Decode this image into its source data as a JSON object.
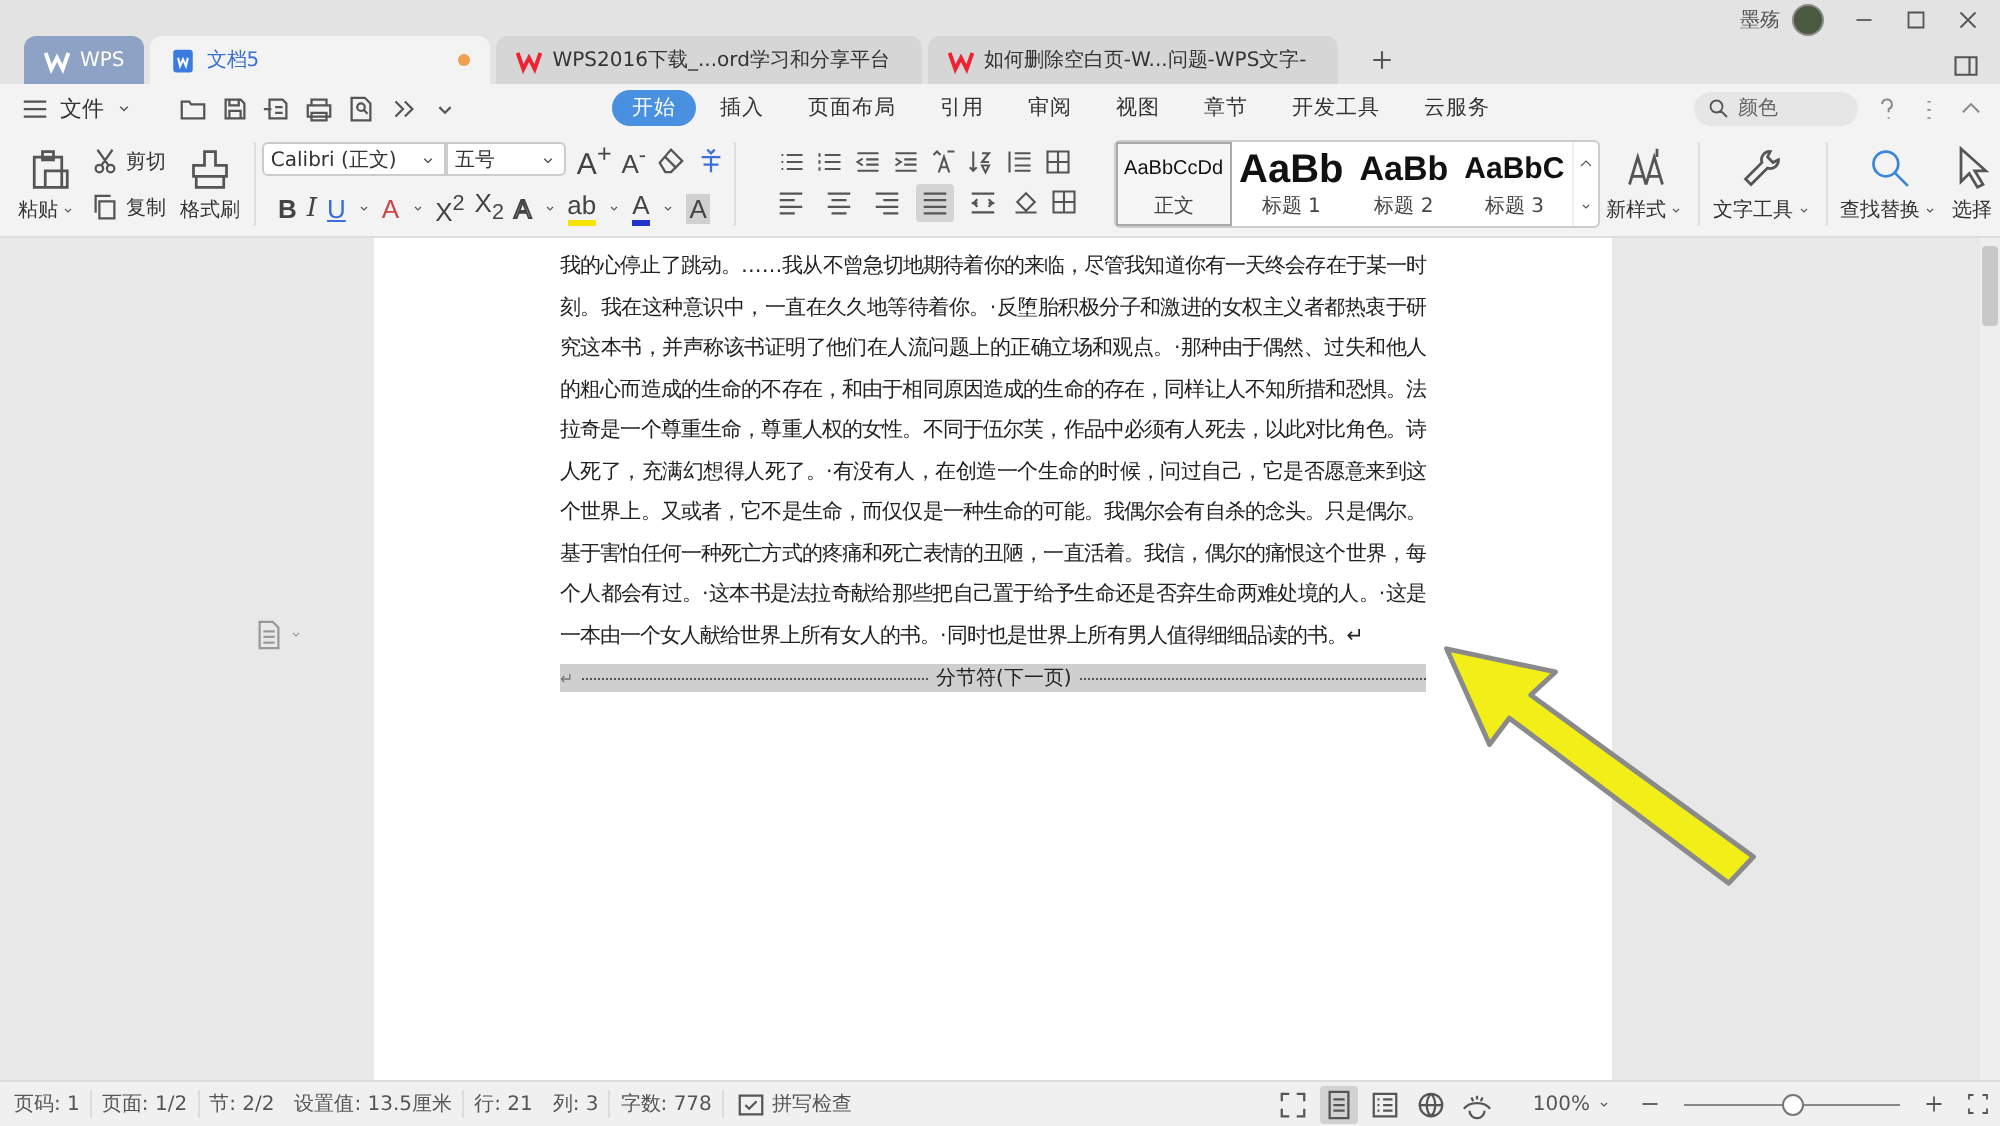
{
  "tabs": [
    {
      "kind": "home",
      "label": "WPS",
      "selected": false,
      "unsaved": false
    },
    {
      "kind": "writer",
      "label": "文档5",
      "selected": true,
      "unsaved": true
    },
    {
      "kind": "web",
      "label": "WPS2016下载_...ord学习和分享平台",
      "selected": false,
      "unsaved": false
    },
    {
      "kind": "web",
      "label": "如何删除空白页-W...问题-WPS文字-",
      "selected": false,
      "unsaved": false
    }
  ],
  "user": {
    "name": "墨殇"
  },
  "menu": {
    "file": "文件",
    "ribbon_tabs": [
      {
        "label": "开始",
        "selected": true
      },
      {
        "label": "插入",
        "selected": false
      },
      {
        "label": "页面布局",
        "selected": false
      },
      {
        "label": "引用",
        "selected": false
      },
      {
        "label": "审阅",
        "selected": false
      },
      {
        "label": "视图",
        "selected": false
      },
      {
        "label": "章节",
        "selected": false
      },
      {
        "label": "开发工具",
        "selected": false
      },
      {
        "label": "云服务",
        "selected": false
      }
    ],
    "search": {
      "value": "颜色"
    }
  },
  "ribbon": {
    "clipboard": {
      "paste": "粘贴",
      "cut": "剪切",
      "copy": "复制",
      "format_painter": "格式刷"
    },
    "font": {
      "name": "Calibri (正文)",
      "size": "五号",
      "row_1": [
        {
          "kind": "grow",
          "label": "A$^{+}$"
        },
        {
          "kind": "shrink",
          "label": "A$^{-}$"
        }
      ],
      "row_2": [
        {
          "kind": "bold",
          "label": "B"
        },
        {
          "kind": "italic",
          "label": "I"
        },
        {
          "kind": "underline",
          "label": "U"
        },
        {
          "kind": "strike",
          "label": "A"
        },
        {
          "kind": "sup",
          "label": "X$^{2}$"
        },
        {
          "kind": "sub",
          "label": "X$_{2}$"
        },
        {
          "kind": "effect",
          "label": "A"
        },
        {
          "kind": "highlight",
          "label": "ab"
        },
        {
          "kind": "color",
          "label": "A"
        },
        {
          "kind": "shade",
          "label": "A"
        }
      ]
    },
    "alignment": [
      {
        "kind": "left",
        "selected": false
      },
      {
        "kind": "center",
        "selected": false
      },
      {
        "kind": "right",
        "selected": false
      },
      {
        "kind": "justify",
        "selected": true
      },
      {
        "kind": "distributed",
        "selected": false
      }
    ],
    "styles": [
      {
        "kind": "body",
        "preview": "AaBbCcDd",
        "label": "正文",
        "selected": true
      },
      {
        "kind": "heading_1",
        "preview": "AaBb",
        "label": "标题 1",
        "selected": false
      },
      {
        "kind": "heading_2",
        "preview": "AaBb",
        "label": "标题 2",
        "selected": false
      },
      {
        "kind": "heading_3",
        "preview": "AaBbC",
        "label": "标题 3",
        "selected": false
      }
    ],
    "buttons": [
      {
        "kind": "new_style",
        "label": "新样式"
      },
      {
        "kind": "text_tools",
        "label": "文字工具"
      },
      {
        "kind": "find",
        "label": "查找替换"
      },
      {
        "kind": "select",
        "label": "选择"
      }
    ]
  },
  "document": {
    "paragraph": "我的心停止了跳动。……我从不曾急切地期待着你的来临，尽管我知道你有一天终会存在于某一时刻。我在这种意识中，一直在久久地等待着你。·反堕胎积极分子和激进的女权主义者都热衷于研究这本书，并声称该书证明了他们在人流问题上的正确立场和观点。·那种由于偶然、过失和他人的粗心而造成的生命的不存在，和由于相同原因造成的生命的存在，同样让人不知所措和恐惧。法拉奇是一个尊重生命，尊重人权的女性。不同于伍尔芙，作品中必须有人死去，以此对比角色。诗人死了，充满幻想得人死了。·有没有人，在创造一个生命的时候，问过自己，它是否愿意来到这个世界上。又或者，它不是生命，而仅仅是一种生命的可能。我偶尔会有自杀的念头。只是偶尔。基于害怕任何一种死亡方式的疼痛和死亡表情的丑陋，一直活着。我信，偶尔的痛恨这个世界，每个人都会有过。·这本书是法拉奇献给那些把自己置于给予生命还是否弃生命两难处境的人。·这是一本由一个女人献给世界上所有女人的书。·同时也是世界上所有男人值得细细品读的书。↵",
    "break_mark": "↵",
    "section_break": "分节符(下一页)"
  },
  "status_bar": {
    "items": [
      "页码: 1",
      "页面: 1/2",
      "节: 2/2",
      "设置值: 13.5厘米",
      "行: 21",
      "列: 3",
      "字数: 778"
    ],
    "spell_check": "拼写检查",
    "views": [
      {
        "kind": "fullscreen",
        "selected": false
      },
      {
        "kind": "page",
        "selected": true
      },
      {
        "kind": "outline",
        "selected": false
      },
      {
        "kind": "web",
        "selected": false
      },
      {
        "kind": "reading",
        "selected": false
      }
    ],
    "zoom": "100%",
    "zoom_slider": {
      "level": 0.5
    }
  }
}
